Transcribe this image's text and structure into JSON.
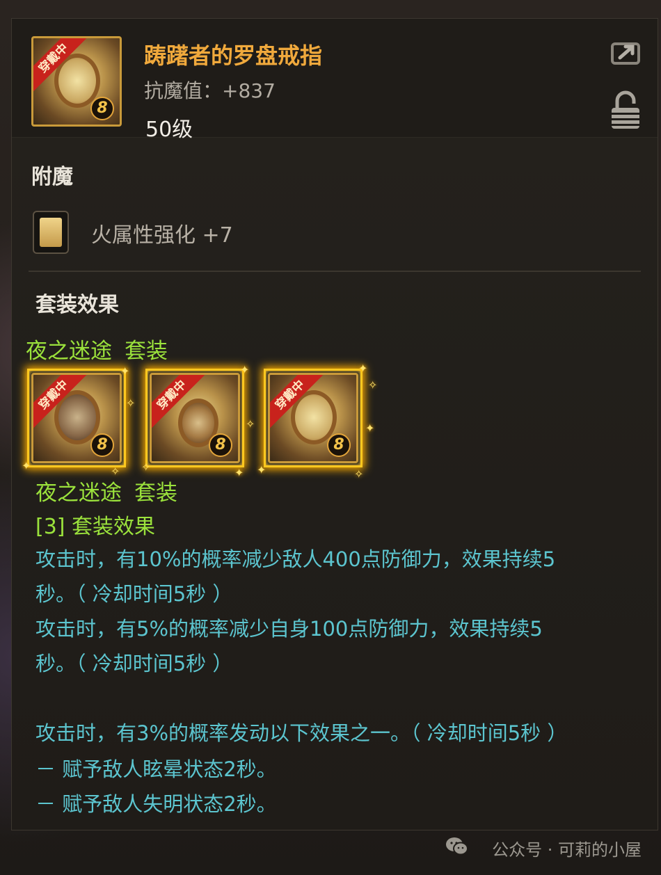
{
  "item": {
    "title": "踌躇者的罗盘戒指",
    "stat": "抗魔值：+837",
    "level": "50级",
    "equipped_badge": "穿戴中",
    "grade_number": "8"
  },
  "enchant": {
    "section_label": "附魔",
    "effect": "火属性强化 +7"
  },
  "set": {
    "section_label": "套装效果",
    "set_name": "夜之迷途",
    "set_suffix": "套装",
    "items": [
      {
        "badge": "穿戴中",
        "grade_number": "8",
        "icon": "compass-necklace-icon"
      },
      {
        "badge": "穿戴中",
        "grade_number": "8",
        "icon": "bracelet-icon"
      },
      {
        "badge": "穿戴中",
        "grade_number": "8",
        "icon": "compass-ring-icon"
      }
    ],
    "effect_title": "[3] 套装效果",
    "lines": [
      "攻击时，有10%的概率减少敌人400点防御力，效果持续5",
      "秒。（ 冷却时间5秒 ）",
      "攻击时，有5%的概率减少自身100点防御力，效果持续5",
      "秒。（ 冷却时间5秒 ）",
      "",
      "攻击时，有3%的概率发动以下效果之一。（ 冷却时间5秒 ）",
      "－ 赋予敌人眩晕状态2秒。",
      "－ 赋予敌人失明状态2秒。"
    ]
  },
  "watermark": "公众号 · 可莉的小屋",
  "colors": {
    "title": "#f0a93c",
    "set_green": "#9be23c",
    "effect_cyan": "#5cc5cf",
    "badge_red": "#c8221c"
  }
}
